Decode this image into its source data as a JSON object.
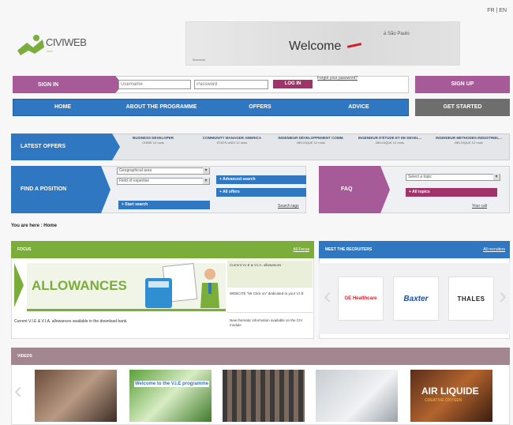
{
  "header": {
    "lang": "FR | EN",
    "logo_text": "CIVIWEB",
    "logo_sub": ".com",
    "banner_title": "Welcome",
    "banner_city": "à São Paulo",
    "banner_credit": "Business"
  },
  "login": {
    "signin_label": "SIGN IN",
    "username_placeholder": "Username",
    "password_placeholder": "Password",
    "login_button": "LOG IN",
    "forgot_link": "Forgot your password?",
    "signup_label": "SIGN UP"
  },
  "nav": {
    "items": [
      "HOME",
      "ABOUT THE PROGRAMME",
      "OFFERS",
      "ADVICE"
    ],
    "get_started": "GET STARTED"
  },
  "offers": {
    "label": "LATEST OFFERS",
    "items": [
      {
        "title": "BUSINESS DEVELOPER",
        "sub": "CHINE 12 mois"
      },
      {
        "title": "COMMUNITY MANAGER AMERICA",
        "sub": "ÉTATS-UNIS 12 mois"
      },
      {
        "title": "INGENIEUR DÉVELOPPEMENT COMM.",
        "sub": "BELGIQUE 12 mois"
      },
      {
        "title": "INGENIEUR D'ÉTUDE ET DE DEVEL...",
        "sub": "BELGIQUE 12 mois"
      },
      {
        "title": "INGENIEUR METHODES INDUSTRIEL...",
        "sub": "BELGIQUE 12 mois"
      }
    ]
  },
  "find": {
    "label": "FIND A POSITION",
    "select_area": "Geographical area",
    "select_field": "Field of expertise",
    "start_search": "+ Start search",
    "advanced_search": "+ Advanced search",
    "all_offers": "+ All offers",
    "search_tags": "Search tags"
  },
  "faq": {
    "label": "FAQ",
    "select_topic": "Select a topic",
    "all_topics": "+ All topics",
    "your_call": "Your call"
  },
  "breadcrumb": "You are here : Home",
  "focus": {
    "header": "FOCUS",
    "header_link": "All Focus",
    "title": "ALLOWANCES",
    "caption": "Current V.I.E & V.I.A. allowances available in the download bank.",
    "news": [
      "Current V.I.E & V.I.A. allowances",
      "WEBCITE \"Mr Click on\" dedicated to your V.I.E",
      "New thematic information available on the CIV module"
    ]
  },
  "recruiters": {
    "header": "MEET THE RECRUITERS",
    "header_link": "All recruiters",
    "logos": [
      "GE Healthcare",
      "Baxter",
      "THALES"
    ]
  },
  "videos": {
    "header": "VIDEOS",
    "thumb2_text": "Welcome to the V.I.E programme",
    "thumb5_text": "AIR LIQUIDE",
    "thumb5_sub": "CREATIVE OXYGEN"
  }
}
